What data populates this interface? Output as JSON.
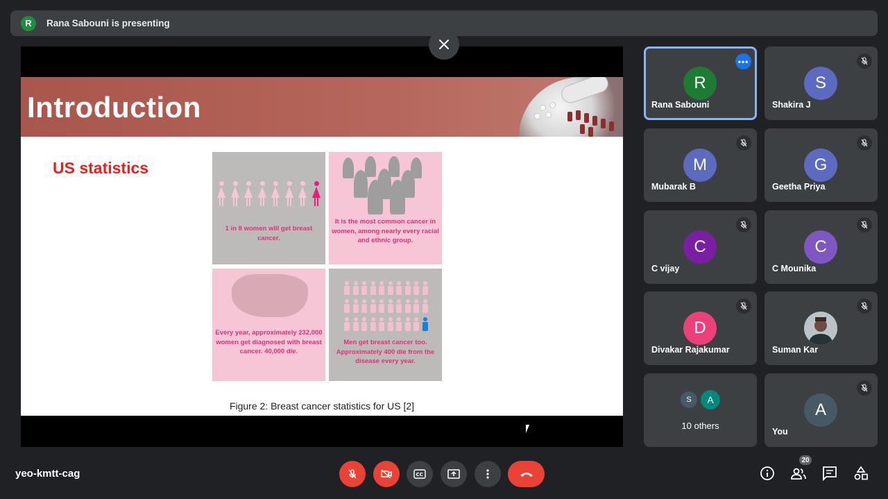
{
  "presenting_bar": {
    "avatar_letter": "R",
    "text": "Rana Sabouni is presenting"
  },
  "slide": {
    "title": "Introduction",
    "subtitle": "US statistics",
    "panels": [
      "1 in 8 women will get breast cancer.",
      "It is the most common cancer in women, among nearly every racial and ethnic group.",
      "Every year, approximately 232,000 women get diagnosed with breast cancer. 40,000 die.",
      "Men get breast cancer too. Approximately 400 die from the disease every year."
    ],
    "caption": "Figure 2: Breast cancer statistics for US [2]"
  },
  "participants": [
    {
      "letter": "R",
      "name": "Rana Sabouni",
      "color": "#1e7b34",
      "active": true
    },
    {
      "letter": "S",
      "name": "Shakira J",
      "color": "#5c6bc0"
    },
    {
      "letter": "M",
      "name": "Mubarak B",
      "color": "#5c6bc0"
    },
    {
      "letter": "G",
      "name": "Geetha Priya",
      "color": "#5c6bc0"
    },
    {
      "letter": "C",
      "name": "C vijay",
      "color": "#7b1fa2"
    },
    {
      "letter": "C",
      "name": "C Mounika",
      "color": "#7e57c2"
    },
    {
      "letter": "D",
      "name": "Divakar Rajakumar",
      "color": "#ec407a"
    },
    {
      "letter": "",
      "name": "Suman Kar",
      "color": "#8d6e63"
    },
    {
      "letter": "A",
      "name": "You",
      "color": "#455a64"
    }
  ],
  "others": {
    "avatars": [
      "S",
      "A"
    ],
    "colors": [
      "#455a64",
      "#00897b"
    ],
    "label": "10 others"
  },
  "bottom_bar": {
    "meeting_code": "yeo-kmtt-cag",
    "participant_count": "20"
  },
  "colors": {
    "background": "#202124",
    "tile": "#3c4043",
    "red": "#ea4335",
    "active_border": "#8ab4f8"
  }
}
